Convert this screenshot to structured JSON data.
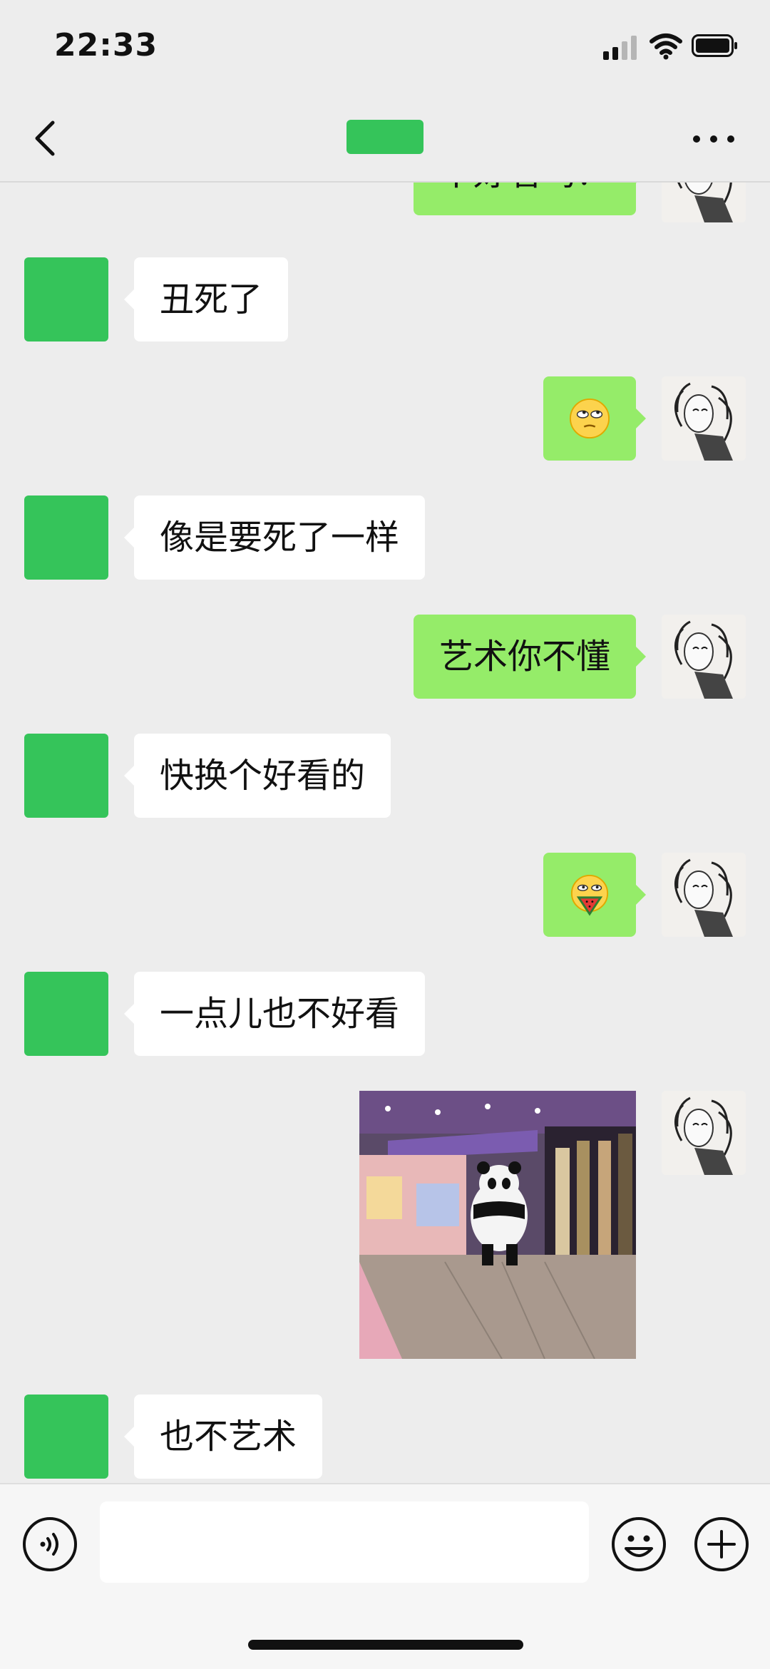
{
  "status_bar": {
    "time": "22:33"
  },
  "nav": {
    "title": ""
  },
  "messages": [
    {
      "side": "right",
      "type": "text",
      "text": "不好看吗？"
    },
    {
      "side": "left",
      "type": "text",
      "text": "丑死了"
    },
    {
      "side": "right",
      "type": "emoji",
      "emoji_name": "eye-roll-emoji"
    },
    {
      "side": "left",
      "type": "text",
      "text": "像是要死了一样"
    },
    {
      "side": "right",
      "type": "text",
      "text": "艺术你不懂"
    },
    {
      "side": "left",
      "type": "text",
      "text": "快换个好看的"
    },
    {
      "side": "right",
      "type": "emoji",
      "emoji_name": "watermelon-emoji"
    },
    {
      "side": "left",
      "type": "text",
      "text": "一点儿也不好看"
    },
    {
      "side": "right",
      "type": "image",
      "image_name": "panda-costume-mall-photo"
    },
    {
      "side": "left",
      "type": "text",
      "text": "也不艺术"
    }
  ],
  "input": {
    "value": "",
    "placeholder": ""
  },
  "colors": {
    "accent": "#35c45a",
    "bubble_right": "#95ec69",
    "bubble_left": "#ffffff",
    "background": "#ededed"
  }
}
